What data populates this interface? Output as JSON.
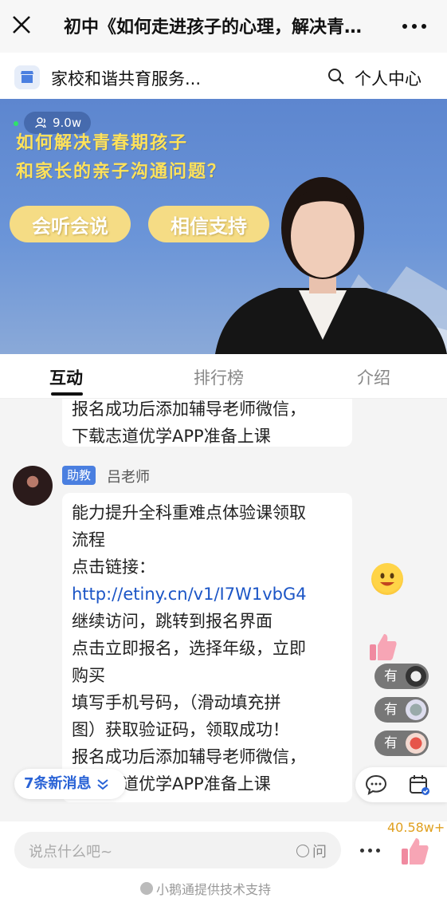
{
  "window": {
    "title": "初中《如何走进孩子的心理，解决青春期孩子和家长的亲子沟通问题》"
  },
  "shop": {
    "name": "家校和谐共育服务...",
    "personal_center": "个人中心"
  },
  "video": {
    "viewer_count": "9.0w",
    "headline_line1": "如何解决青春期孩子",
    "headline_line2": "和家长的亲子沟通问题？",
    "tag1": "会听会说",
    "tag2": "相信支持"
  },
  "tabs": [
    {
      "label": "互动",
      "active": true
    },
    {
      "label": "排行榜",
      "active": false
    },
    {
      "label": "介绍",
      "active": false
    }
  ],
  "chat": {
    "prev_message": {
      "line1": "报名成功后添加辅导老师微信，",
      "line2": "下载志道优学APP准备上课"
    },
    "message": {
      "role": "助教",
      "sender": "吕老师",
      "lines": [
        "能力提升全科重难点体验课领取",
        "流程",
        "点击链接：",
        "http://etiny.cn/v1/I7W1vbG4",
        "继续访问，跳转到报名界面",
        "点击立即报名，选择年级，立即",
        "购买",
        "填写手机号码，（滑动填充拼",
        "图）获取验证码，领取成功！",
        "报名成功后添加辅导老师微信，",
        "下载志道优学APP准备上课"
      ]
    },
    "presence_label": "有",
    "new_messages": "7条新消息"
  },
  "bottom": {
    "input_placeholder": "说点什么吧~",
    "ask_label": "问",
    "likes": "40.58w+",
    "footer": "小鹅通提供技术支持"
  }
}
